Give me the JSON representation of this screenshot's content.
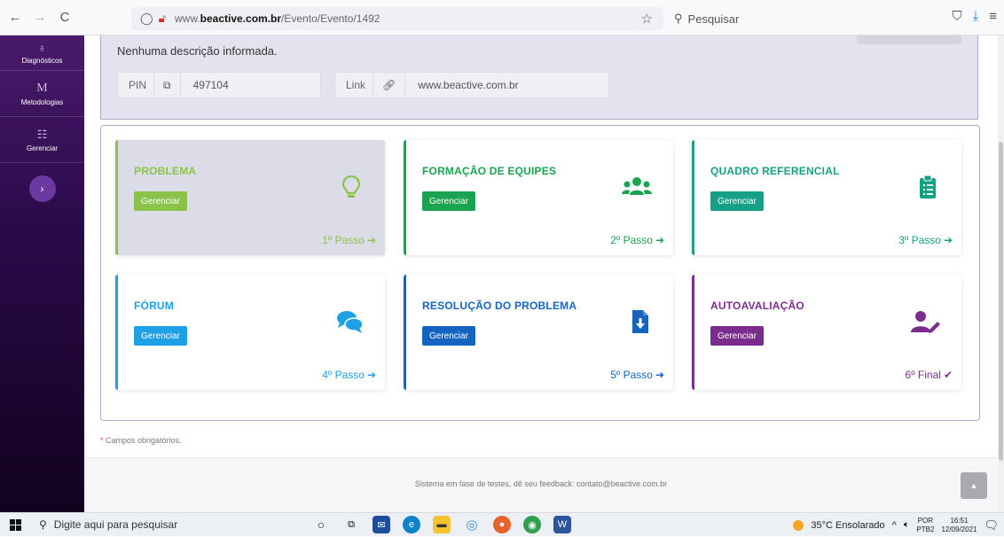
{
  "browser": {
    "url_prefix": "www.",
    "url_domain": "beactive.com.br",
    "url_path": "/Evento/Evento/1492",
    "search_placeholder": "Pesquisar",
    "back_glyph": "←",
    "forward_glyph": "→",
    "reload_glyph": "C"
  },
  "sidebar": {
    "items": [
      {
        "label": "Diagnósticos",
        "icon": "stethoscope-icon"
      },
      {
        "label": "Metodologias",
        "icon": "m-letter-icon",
        "glyph": "M"
      },
      {
        "label": "Gerenciar",
        "icon": "list-icon",
        "glyph": "☷"
      }
    ],
    "toggle_glyph": "›"
  },
  "event": {
    "description": "Nenhuma descrição informada.",
    "pin_label": "PIN",
    "pin_value": "497104",
    "link_label": "Link",
    "link_value": "www.beactive.com.br"
  },
  "steps": [
    {
      "title": "PROBLEMA",
      "button": "Gerenciar",
      "step": "1º Passo",
      "step_glyph": "➔",
      "color": "#8bc34a",
      "icon": "lightbulb-icon"
    },
    {
      "title": "FORMAÇÃO DE EQUIPES",
      "button": "Gerenciar",
      "step": "2º Passo",
      "step_glyph": "➔",
      "color": "#1aa350",
      "icon": "team-icon"
    },
    {
      "title": "QUADRO REFERENCIAL",
      "button": "Gerenciar",
      "step": "3º Passo",
      "step_glyph": "➔",
      "color": "#16a085",
      "icon": "clipboard-icon"
    },
    {
      "title": "FÓRUM",
      "button": "Gerenciar",
      "step": "4º Passo",
      "step_glyph": "➔",
      "color": "#1ea0e6",
      "icon": "chat-icon"
    },
    {
      "title": "RESOLUÇÃO DO PROBLEMA",
      "button": "Gerenciar",
      "step": "5º Passo",
      "step_glyph": "➔",
      "color": "#1565c0",
      "icon": "file-download-icon"
    },
    {
      "title": "AUTOAVALIAÇÃO",
      "button": "Gerenciar",
      "step": "6º Final",
      "step_glyph": "✔",
      "color": "#7b2d8e",
      "icon": "user-edit-icon"
    }
  ],
  "footnote": {
    "marker": "*",
    "text": "Campos obrigatórios."
  },
  "footer": {
    "text": "Sistema em fase de testes, dê seu feedback: contato@beactive.com.br",
    "scroll_glyph": "▲"
  },
  "taskbar": {
    "search_placeholder": "Digite aqui para pesquisar",
    "weather": "35°C Ensolarado",
    "lang_top": "POR",
    "lang_bottom": "PTB2",
    "time": "16:51",
    "date": "12/09/2021"
  }
}
